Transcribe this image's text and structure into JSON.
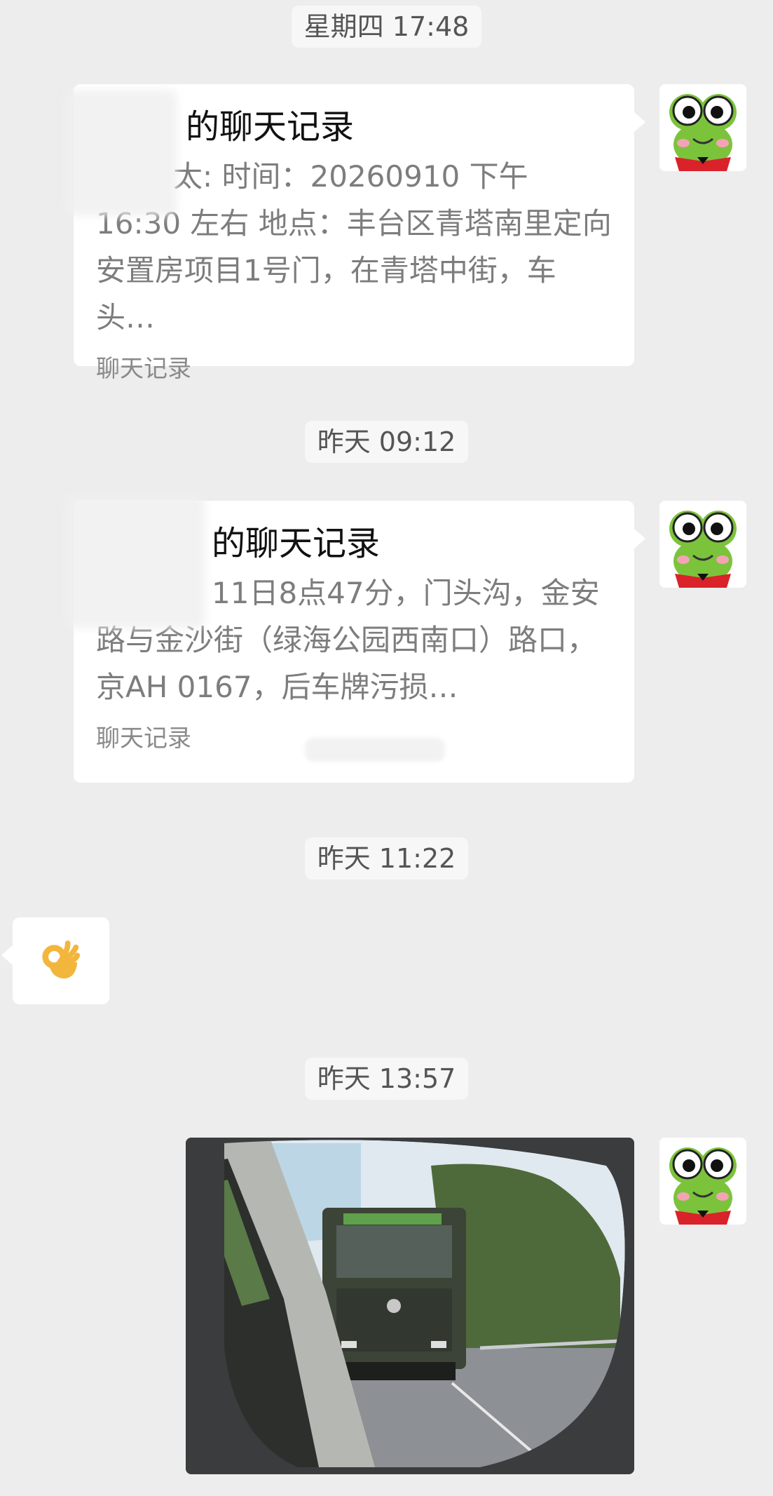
{
  "messages": [
    {
      "timestamp": "星期四 17:48"
    },
    {
      "timestamp": "昨天 09:12"
    },
    {
      "timestamp": "昨天 11:22"
    },
    {
      "timestamp": "昨天 13:57"
    }
  ],
  "card1": {
    "title": "的聊天记录",
    "body": "太: 时间：20260910 下午 16:30 左右 地点：丰台区青塔南里定向安置房项目1号门，在青塔中街，车头…",
    "footer": "聊天记录"
  },
  "card2": {
    "title": "的聊天记录",
    "body": "11日8点47分，门头沟，金安路与金沙街（绿海公园西南口）路口，京AH 0167，后车牌污损…",
    "footer": "聊天记录"
  },
  "icons": {
    "avatar": "frog-avatar-icon",
    "emoji": "ok-hand-icon"
  },
  "colors": {
    "background": "#ededed",
    "bubble": "#ffffff",
    "frog_green": "#7cc33c",
    "frog_scarf": "#d9222a"
  }
}
